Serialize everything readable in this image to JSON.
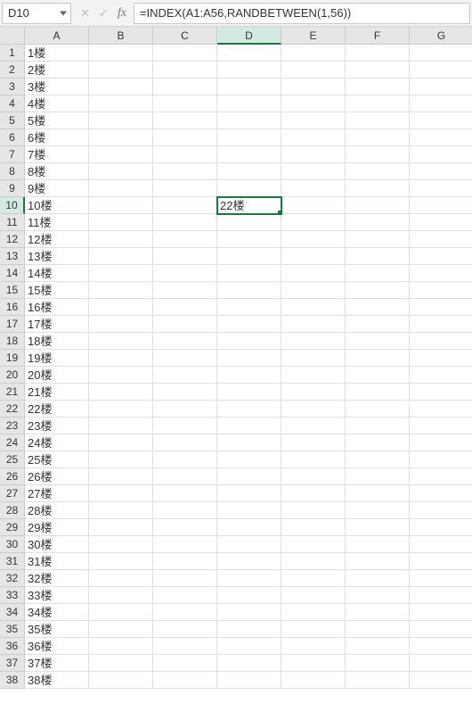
{
  "formula_bar": {
    "name_box": "D10",
    "cancel_icon": "✕",
    "enter_icon": "✓",
    "fx_label": "fx",
    "formula": "=INDEX(A1:A56,RANDBETWEEN(1,56))"
  },
  "columns": [
    "A",
    "B",
    "C",
    "D",
    "E",
    "F",
    "G"
  ],
  "row_count": 38,
  "selected": {
    "row": 10,
    "col": 4
  },
  "cells": {
    "A": [
      "1楼",
      "2楼",
      "3楼",
      "4楼",
      "5楼",
      "6楼",
      "7楼",
      "8楼",
      "9楼",
      "10楼",
      "11楼",
      "12楼",
      "13楼",
      "14楼",
      "15楼",
      "16楼",
      "17楼",
      "18楼",
      "19楼",
      "20楼",
      "21楼",
      "22楼",
      "23楼",
      "24楼",
      "25楼",
      "26楼",
      "27楼",
      "28楼",
      "29楼",
      "30楼",
      "31楼",
      "32楼",
      "33楼",
      "34楼",
      "35楼",
      "36楼",
      "37楼",
      "38楼"
    ],
    "D10": "22楼"
  }
}
